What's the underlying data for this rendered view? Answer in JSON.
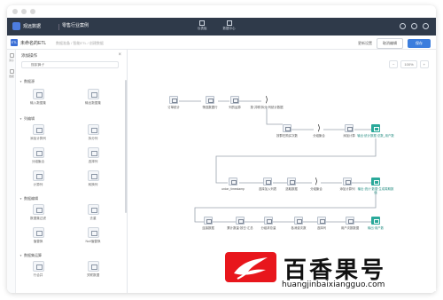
{
  "window": {
    "dots": 3
  },
  "topbar": {
    "brand": "观远数据",
    "tabs": [
      "零售行业案例"
    ],
    "center_tabs": [
      {
        "label": "仪表板",
        "icon": "dashboard-icon"
      },
      {
        "label": "数据中心",
        "icon": "data-center-icon"
      }
    ],
    "right_icons": [
      "help-icon",
      "settings-icon",
      "user-icon"
    ]
  },
  "subbar": {
    "badge": "ETL",
    "task_name": "未命名的ETL",
    "breadcrumb": "数据准备 / 智能ETL / 创建数据",
    "link": "更新设置",
    "outline_button": "取消编辑",
    "primary_button": "保存"
  },
  "rail": [
    {
      "label": "算子",
      "icon": "operator-icon"
    },
    {
      "label": "数据",
      "icon": "data-icon"
    }
  ],
  "panel": {
    "title": "添加操作",
    "search_placeholder": "搜索算子",
    "groups": [
      {
        "label": "数据源",
        "items": [
          "输入数据集",
          "输出数据集"
        ]
      },
      {
        "label": "列编辑",
        "items": [
          "添加计算列",
          "拆分列",
          "分组聚合",
          "选择列",
          "计算列",
          "转换列"
        ]
      },
      {
        "label": "数据编辑",
        "items": [
          "数据集过滤",
          "去重",
          "值替换",
          "Null值替换"
        ]
      },
      {
        "label": "数据集运算",
        "items": [
          "行合并",
          "关联数据"
        ]
      }
    ]
  },
  "canvas": {
    "zoom_out": "−",
    "zoom_value": "100%",
    "zoom_in": "+",
    "nodes": [
      {
        "label": "订单统计",
        "kind": "source"
      },
      {
        "label": "筛选数据行",
        "kind": "table"
      },
      {
        "label": "列的运算",
        "kind": "table"
      },
      {
        "label": "按·并联/拆分·列统计数据",
        "kind": "merge"
      },
      {
        "label": "按群在购买次数",
        "kind": "table"
      },
      {
        "label": "分组聚合",
        "kind": "merge"
      },
      {
        "label": "添加计算",
        "kind": "table"
      },
      {
        "label": "输出·统计数据·总数_用户数",
        "kind": "output"
      },
      {
        "label": "union_timestamp",
        "kind": "table"
      },
      {
        "label": "选择加入列表",
        "kind": "table"
      },
      {
        "label": "选取数据",
        "kind": "table"
      },
      {
        "label": "分组聚合",
        "kind": "merge"
      },
      {
        "label": "添加计算列",
        "kind": "table"
      },
      {
        "label": "输出·统计·数据·生成周期数值",
        "kind": "output"
      },
      {
        "label": "连接数据",
        "kind": "table"
      },
      {
        "label": "累计数量·按日·汇总",
        "kind": "table"
      },
      {
        "label": "分组求总量",
        "kind": "table"
      },
      {
        "label": "各消费次数",
        "kind": "table"
      },
      {
        "label": "选择列",
        "kind": "table"
      },
      {
        "label": "用户次数数据",
        "kind": "table"
      },
      {
        "label": "输出·用户数",
        "kind": "output"
      }
    ]
  },
  "watermark": {
    "title": "百香果号",
    "url": "huangjinbaixiangguo.com"
  },
  "colors": {
    "topbar": "#2f3a4a",
    "primary": "#3b7ddd",
    "teal": "#2aa99a",
    "logo_red": "#e8161c"
  }
}
